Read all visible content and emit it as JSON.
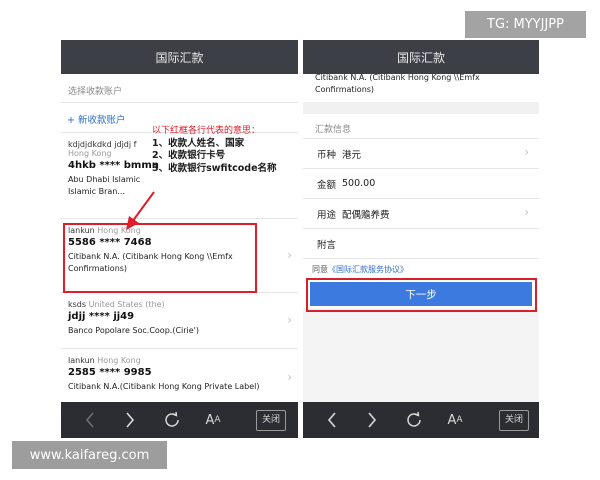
{
  "left_screen": {
    "title": "国际汇款",
    "section_label": "选择收款账户",
    "add_account": "+ 新收款账户",
    "accounts": [
      {
        "holder": "kdjdjdkdkd jdjdj f",
        "country": "Hong Kong",
        "number": "4hkb **** bmmn",
        "bank": "Abu Dhabi Islamic Islamic Bran..."
      },
      {
        "holder": "lankun",
        "country": "Hong Kong",
        "number": "5586 **** 7468",
        "bank": "Citibank N.A. (Citibank Hong Kong \\\\Emfx Confirmations)"
      },
      {
        "holder": "ksds",
        "country": "United States (the)",
        "number": "jdjj **** jj49",
        "bank": "Banco Popolare Soc.Coop.(Cirie')"
      },
      {
        "holder": "lankun",
        "country": "Hong Kong",
        "number": "2585 **** 9985",
        "bank": "Citibank N.A.(Citibank Hong Kong Private Label)"
      }
    ],
    "annotation": {
      "heading": "以下红框各行代表的意思：",
      "lines": [
        "1、收款人姓名、国家",
        "2、收款银行卡号",
        "3、收款银行swfitcode名称"
      ]
    },
    "bottom_bar": {
      "close": "关闭"
    }
  },
  "right_screen": {
    "title": "国际汇款",
    "account_bank": "Citibank N.A. (Citibank Hong Kong \\\\Emfx Confirmations)",
    "section_label": "汇款信息",
    "rows": [
      {
        "label": "币种",
        "value": "港元"
      },
      {
        "label": "金额",
        "value": "500.00"
      },
      {
        "label": "用途",
        "value": "配偶赡养费"
      },
      {
        "label": "附言",
        "value": ""
      }
    ],
    "agree_prefix": "同意",
    "agree_link": "《国际汇款服务协议》",
    "next_button": "下一步",
    "bottom_bar": {
      "close": "关闭"
    }
  },
  "watermarks": {
    "top_right": "TG: MYYJJPP",
    "bottom_left": "www.kaifareg.com"
  },
  "colors": {
    "highlight": "#e01d2b",
    "primary_button": "#3d7ae0",
    "link": "#2f6fc4",
    "title_bar": "#3c3f46"
  },
  "icons": [
    "back-icon",
    "forward-icon",
    "refresh-icon",
    "font-size-icon",
    "chevron-right-icon",
    "annotation-arrow-icon"
  ]
}
